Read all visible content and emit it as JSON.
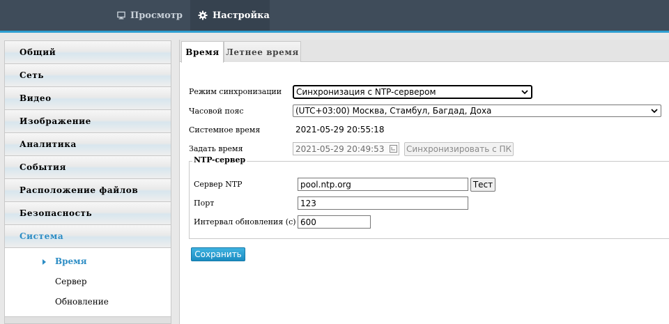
{
  "topnav": {
    "view_label": "Просмотр",
    "settings_label": "Настройка"
  },
  "sidebar": {
    "items": [
      {
        "label": "Общий"
      },
      {
        "label": "Сеть"
      },
      {
        "label": "Видео"
      },
      {
        "label": "Изображение"
      },
      {
        "label": "Аналитика"
      },
      {
        "label": "События"
      },
      {
        "label": "Расположение файлов"
      },
      {
        "label": "Безопасность"
      },
      {
        "label": "Система"
      }
    ],
    "subitems": [
      {
        "label": "Время"
      },
      {
        "label": "Сервер"
      },
      {
        "label": "Обновление"
      }
    ]
  },
  "tabs": {
    "time": "Время",
    "dst": "Летнее время"
  },
  "form": {
    "sync_mode_label": "Режим синхронизации",
    "sync_mode_value": "Синхронизация с NTP-сервером",
    "timezone_label": "Часовой пояс",
    "timezone_value": "(UTC+03:00) Москва, Стамбул, Багдад, Доха",
    "system_time_label": "Системное время",
    "system_time_value": "2021-05-29 20:55:18",
    "set_time_label": "Задать время",
    "set_time_value": "2021-05-29 20:49:53",
    "sync_pc_button": "Синхронизировать с ПК"
  },
  "ntp": {
    "legend": "NTP-сервер",
    "server_label": "Сервер NTP",
    "server_value": "pool.ntp.org",
    "test_button": "Тест",
    "port_label": "Порт",
    "port_value": "123",
    "interval_label": "Интервал обновления (с)",
    "interval_value": "600"
  },
  "save_button": "Сохранить",
  "colors": {
    "topbar": "#3f4c5a",
    "accent": "#2e9fd1",
    "active_text": "#2b8cc4"
  }
}
